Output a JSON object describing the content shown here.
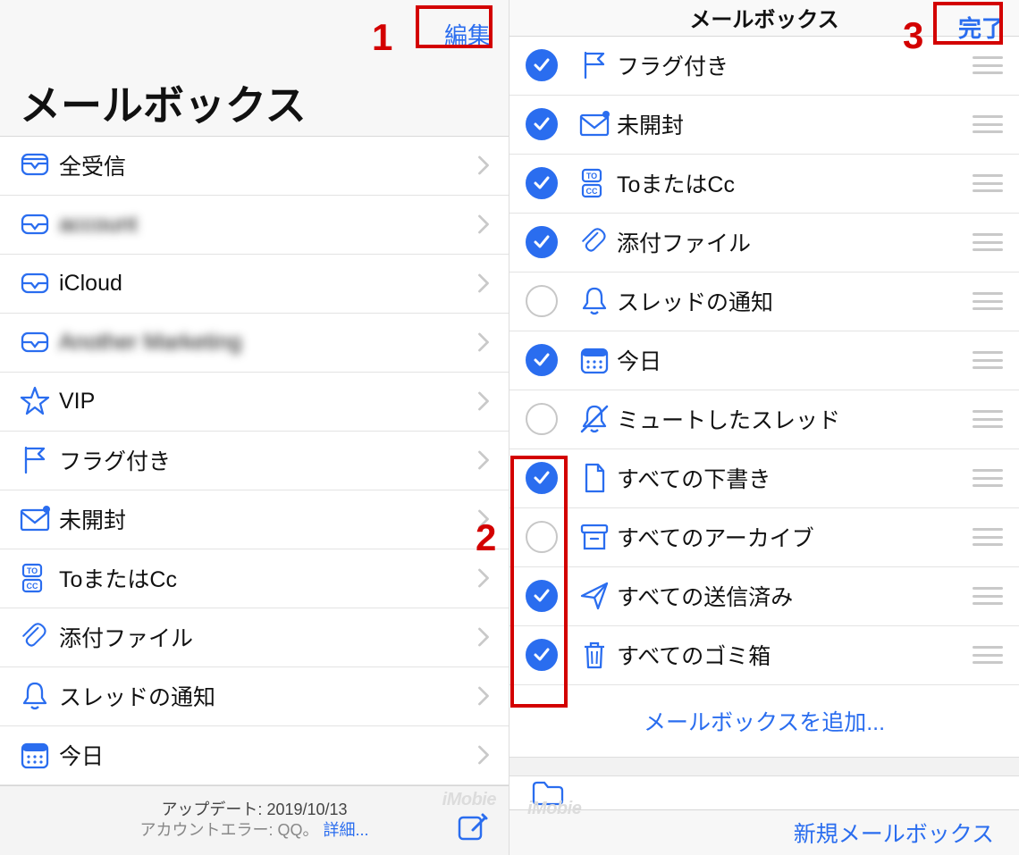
{
  "left": {
    "edit": "編集",
    "title": "メールボックス",
    "items": [
      {
        "icon": "inbox-all",
        "label": "全受信",
        "blur": false
      },
      {
        "icon": "inbox",
        "label": "account",
        "blur": true
      },
      {
        "icon": "inbox",
        "label": "iCloud",
        "blur": false
      },
      {
        "icon": "inbox",
        "label": "Another Marketing",
        "blur": true
      },
      {
        "icon": "star",
        "label": "VIP",
        "blur": false
      },
      {
        "icon": "flag",
        "label": "フラグ付き",
        "blur": false
      },
      {
        "icon": "envelope-dot",
        "label": "未開封",
        "blur": false
      },
      {
        "icon": "tocc",
        "label": "ToまたはCc",
        "blur": false
      },
      {
        "icon": "paperclip",
        "label": "添付ファイル",
        "blur": false
      },
      {
        "icon": "bell",
        "label": "スレッドの通知",
        "blur": false
      },
      {
        "icon": "calendar",
        "label": "今日",
        "blur": false
      }
    ],
    "footer": {
      "update": "アップデート: 2019/10/13",
      "error_prefix": "アカウントエラー: QQ。",
      "more": "詳細...",
      "watermark": "iMobie"
    }
  },
  "right": {
    "title": "メールボックス",
    "done": "完了",
    "items": [
      {
        "checked": true,
        "icon": "flag",
        "label": "フラグ付き"
      },
      {
        "checked": true,
        "icon": "envelope-dot",
        "label": "未開封"
      },
      {
        "checked": true,
        "icon": "tocc",
        "label": "ToまたはCc"
      },
      {
        "checked": true,
        "icon": "paperclip",
        "label": "添付ファイル"
      },
      {
        "checked": false,
        "icon": "bell",
        "label": "スレッドの通知"
      },
      {
        "checked": true,
        "icon": "calendar",
        "label": "今日"
      },
      {
        "checked": false,
        "icon": "bell-mute",
        "label": "ミュートしたスレッド"
      },
      {
        "checked": true,
        "icon": "doc",
        "label": "すべての下書き"
      },
      {
        "checked": false,
        "icon": "archive",
        "label": "すべてのアーカイブ"
      },
      {
        "checked": true,
        "icon": "paperplane",
        "label": "すべての送信済み"
      },
      {
        "checked": true,
        "icon": "trash",
        "label": "すべてのゴミ箱"
      }
    ],
    "add_mailbox": "メールボックスを追加...",
    "new_mailbox": "新規メールボックス",
    "watermark": "iMobie"
  },
  "annotations": {
    "n1": "1",
    "n2": "2",
    "n3": "3"
  }
}
